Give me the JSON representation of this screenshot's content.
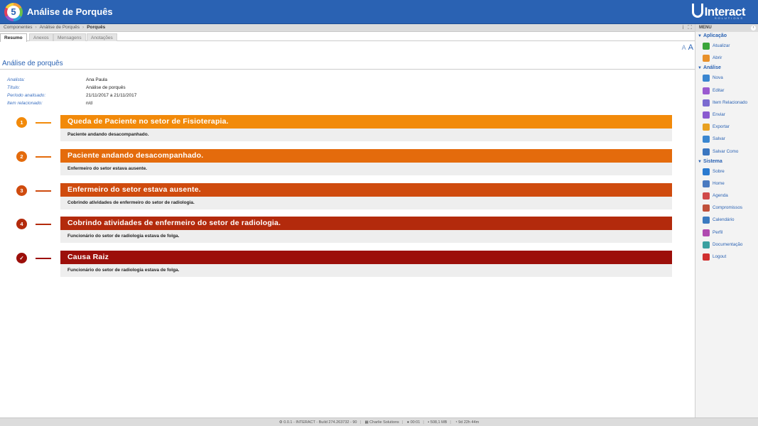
{
  "app": {
    "logo_number": "5",
    "title": "Análise de Porquês",
    "brand": "Interact",
    "brand_sub": "SOLUTIONS"
  },
  "breadcrumb": [
    "Componentes",
    "Análise de Porquês",
    "Porquês"
  ],
  "crumb_tools": {
    "info": "i",
    "fullscreen": "⛶"
  },
  "tabs": [
    "Resumo",
    "Anexos",
    "Mensagens",
    "Anotações"
  ],
  "font_controls": {
    "decrease": "A",
    "increase": "A"
  },
  "section_title": "Análise de porquês",
  "meta": {
    "analyst_label": "Analista:",
    "analyst": "Ana Paula",
    "title_label": "Título:",
    "title": "Análise de porquês",
    "period_label": "Período analisado:",
    "period": "21/11/2017 a 21/11/2017",
    "item_label": "Item relacionado:",
    "item": "n/d"
  },
  "whys": [
    {
      "badge": "1",
      "heading": "Queda de Paciente no setor de Fisioterapia.",
      "answer": "Paciente andando desacompanhado.",
      "color": "#f28a0a"
    },
    {
      "badge": "2",
      "heading": "Paciente andando desacompanhado.",
      "answer": "Enfermeiro do setor estava ausente.",
      "color": "#e46b0c"
    },
    {
      "badge": "3",
      "heading": "Enfermeiro do setor estava ausente.",
      "answer": "Cobrindo atividades de enfermeiro do setor de radiologia.",
      "color": "#cf4b0e"
    },
    {
      "badge": "4",
      "heading": "Cobrindo atividades de enfermeiro do setor de radiologia.",
      "answer": "Funcionário do setor de radiologia estava de folga.",
      "color": "#b32a0c"
    },
    {
      "badge": "✓",
      "heading": "Causa Raiz",
      "answer": "Funcionário do setor de radiologia estava de folga.",
      "color": "#9c0f0a"
    }
  ],
  "sidebar": {
    "menu_label": "MENU",
    "collapse": "›",
    "groups": [
      {
        "title": "Aplicação",
        "items": [
          {
            "label": "Atualizar",
            "icon": "refresh-icon",
            "color": "#3aa53a"
          },
          {
            "label": "Abrir",
            "icon": "folder-icon",
            "color": "#e8902a"
          }
        ]
      },
      {
        "title": "Análise",
        "items": [
          {
            "label": "Nova",
            "icon": "new-icon",
            "color": "#3a86d0"
          },
          {
            "label": "Editar",
            "icon": "edit-icon",
            "color": "#9a5ad0"
          },
          {
            "label": "Item Relacionado",
            "icon": "link-icon",
            "color": "#7a6ad0"
          },
          {
            "label": "Enviar",
            "icon": "send-icon",
            "color": "#8a5ad0"
          },
          {
            "label": "Exportar",
            "icon": "export-icon",
            "color": "#e8a020"
          },
          {
            "label": "Salvar",
            "icon": "save-icon",
            "color": "#3a86d0"
          },
          {
            "label": "Salvar Como",
            "icon": "save-as-icon",
            "color": "#3a76c0"
          }
        ]
      },
      {
        "title": "Sistema",
        "items": [
          {
            "label": "Sobre",
            "icon": "info-icon",
            "color": "#2a7ad0"
          },
          {
            "label": "Home",
            "icon": "home-icon",
            "color": "#4a7ac0"
          },
          {
            "label": "Agenda",
            "icon": "agenda-icon",
            "color": "#d04a4a"
          },
          {
            "label": "Compromissos",
            "icon": "appointments-icon",
            "color": "#c0503a"
          },
          {
            "label": "Calendário",
            "icon": "calendar-icon",
            "color": "#3a7ac0"
          },
          {
            "label": "Perfil",
            "icon": "profile-icon",
            "color": "#b04ab0"
          },
          {
            "label": "Documentação",
            "icon": "docs-icon",
            "color": "#3aa0a0"
          },
          {
            "label": "Logout",
            "icon": "logout-icon",
            "color": "#d03030"
          }
        ]
      }
    ]
  },
  "status": {
    "build": "0.0.1 - INTERACT - Build 274.263732 - 90",
    "company": "Charlie Solutions",
    "time": "00:01",
    "memory": "508,1 MB",
    "uptime": "9d 22h 44m"
  }
}
